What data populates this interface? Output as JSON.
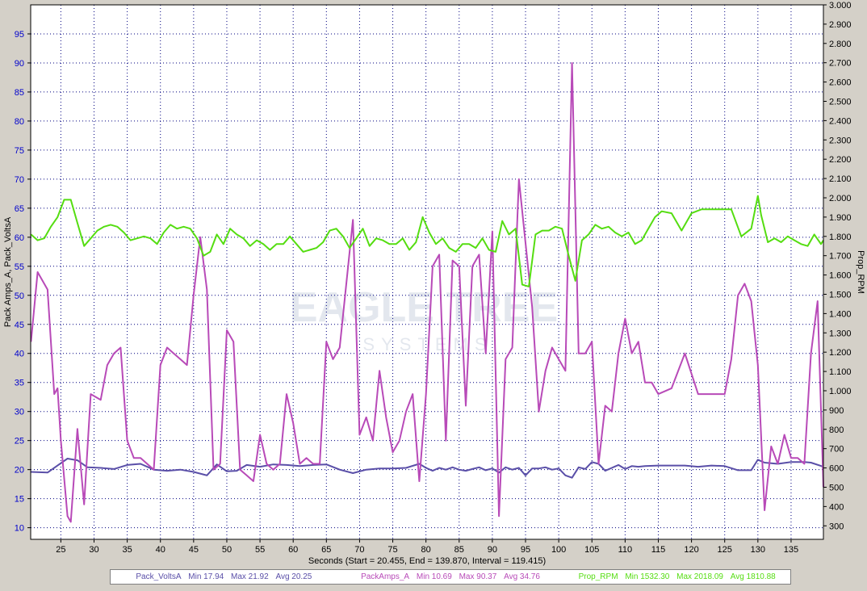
{
  "chart_data": {
    "type": "line",
    "xlabel": "Seconds (Start = 20.455, End = 139.870, Interval = 119.415)",
    "ylabel_left": "Pack Amps_A, Pack_VoltsA",
    "ylabel_right": "Prop_RPM",
    "xlim": [
      20.455,
      139.87
    ],
    "ylim_left": [
      8,
      100
    ],
    "ylim_right": [
      230,
      3000
    ],
    "x_ticks": [
      25,
      30,
      35,
      40,
      45,
      50,
      55,
      60,
      65,
      70,
      75,
      80,
      85,
      90,
      95,
      100,
      105,
      110,
      115,
      120,
      125,
      130,
      135
    ],
    "y_left_ticks": [
      10,
      15,
      20,
      25,
      30,
      35,
      40,
      45,
      50,
      55,
      60,
      65,
      70,
      75,
      80,
      85,
      90,
      95
    ],
    "y_right_ticks": [
      "300",
      "400",
      "500",
      "600",
      "700",
      "800",
      "900",
      "1.000",
      "1.100",
      "1.200",
      "1.300",
      "1.400",
      "1.500",
      "1.600",
      "1.700",
      "1.800",
      "1.900",
      "2.000",
      "2.100",
      "2.200",
      "2.300",
      "2.400",
      "2.500",
      "2.600",
      "2.700",
      "2.800",
      "2.900",
      "3.000"
    ],
    "grid": true,
    "watermark_text": "EAGLE TREE",
    "watermark_sub": "SYSTEMS",
    "series": [
      {
        "name": "Pack_VoltsA",
        "axis": "left",
        "color": "#5a4fa8",
        "legend": {
          "name": "Pack_VoltsA",
          "min": "Min 17.94",
          "max": "Max 21.92",
          "avg": "Avg 20.25"
        },
        "x": [
          20.5,
          23,
          24.5,
          26,
          27.5,
          29,
          31,
          33,
          35,
          37,
          39,
          41,
          43,
          45,
          47,
          48.5,
          50,
          51.5,
          53,
          55,
          57,
          59,
          61,
          63,
          65,
          67,
          69,
          71,
          73,
          75,
          77,
          79,
          80,
          81,
          82,
          83,
          84,
          85,
          86,
          87,
          88,
          89,
          90,
          91,
          92,
          93,
          94,
          95,
          96,
          97,
          98,
          99,
          100,
          101,
          102,
          103,
          104,
          105,
          106,
          107,
          108,
          109,
          110,
          111,
          112,
          113,
          115,
          117,
          119,
          121,
          123,
          125,
          127,
          128,
          129,
          130,
          131,
          133,
          135,
          137,
          138,
          139.87
        ],
        "y": [
          19.6,
          19.5,
          20.7,
          21.9,
          21.6,
          20.4,
          20.3,
          20.1,
          20.8,
          21.0,
          20.0,
          19.8,
          20.0,
          19.6,
          19.0,
          20.9,
          19.7,
          19.8,
          20.8,
          20.5,
          20.9,
          20.8,
          20.6,
          20.8,
          20.9,
          20.0,
          19.4,
          20.0,
          20.2,
          20.2,
          20.3,
          21.0,
          20.3,
          19.8,
          20.3,
          20.0,
          20.4,
          20.0,
          19.8,
          20.1,
          20.4,
          19.9,
          20.2,
          19.5,
          20.4,
          20.0,
          20.3,
          19.0,
          20.2,
          20.2,
          20.4,
          20.0,
          20.2,
          19.0,
          18.6,
          20.4,
          20.1,
          21.3,
          21.0,
          19.8,
          20.3,
          20.8,
          20.1,
          20.6,
          20.5,
          20.6,
          20.7,
          20.7,
          20.7,
          20.5,
          20.7,
          20.6,
          19.9,
          19.9,
          19.9,
          21.7,
          21.2,
          21.0,
          21.3,
          21.3,
          21.2,
          20.5
        ]
      },
      {
        "name": "PackAmps_A",
        "axis": "left",
        "color": "#b84ab8",
        "legend": {
          "name": "PackAmps_A",
          "min": "Min 10.69",
          "max": "Max 90.37",
          "avg": "Avg 34.76"
        },
        "x": [
          20.5,
          21.5,
          23,
          24,
          24.5,
          25,
          26,
          26.5,
          27.5,
          28.5,
          29.5,
          31,
          32,
          33,
          34,
          35,
          36,
          37,
          38,
          39,
          40,
          41,
          42,
          43,
          44,
          45,
          46,
          47,
          48,
          49,
          50,
          51,
          52,
          53,
          54,
          55,
          56,
          57,
          58,
          59,
          60,
          61,
          62,
          63,
          64,
          65,
          66,
          67,
          68,
          69,
          70,
          71,
          72,
          73,
          74,
          75,
          76,
          77,
          78,
          79,
          80,
          81,
          82,
          83,
          84,
          85,
          86,
          87,
          88,
          89,
          90,
          91,
          92,
          93,
          94,
          95,
          96,
          97,
          98,
          99,
          100,
          101,
          102,
          103,
          104,
          105,
          106,
          107,
          108,
          109,
          110,
          111,
          112,
          113,
          114,
          115,
          117,
          119,
          121,
          123,
          125,
          126,
          127,
          128,
          129,
          130,
          131,
          132,
          133,
          134,
          135,
          136,
          137,
          138,
          139,
          139.87
        ],
        "y": [
          42,
          54,
          51,
          33,
          34,
          25,
          12,
          11,
          27,
          14,
          33,
          32,
          38,
          40,
          41,
          25,
          22,
          22,
          21,
          20,
          38,
          41,
          40,
          39,
          38,
          50,
          60,
          51,
          20,
          21,
          44,
          42,
          20,
          19,
          18,
          26,
          21,
          20,
          21,
          33,
          28,
          21,
          22,
          21,
          21,
          42,
          39,
          41,
          52,
          63,
          26,
          29,
          25,
          37,
          29,
          23,
          25,
          30,
          33,
          18,
          33,
          55,
          57,
          25,
          56,
          55,
          31,
          55,
          57,
          40,
          61,
          12,
          39,
          41,
          70,
          59,
          48,
          30,
          37,
          41,
          39,
          37,
          90,
          40,
          40,
          42,
          21,
          31,
          30,
          40,
          46,
          40,
          42,
          35,
          35,
          33,
          34,
          40,
          33,
          33,
          33,
          39,
          50,
          52,
          49,
          38,
          13,
          24,
          21,
          26,
          22,
          22,
          21,
          40,
          49,
          17
        ]
      },
      {
        "name": "Prop_RPM",
        "axis": "right",
        "color": "#55dd11",
        "legend": {
          "name": "Prop_RPM",
          "min": "Min 1532.30",
          "max": "Max 2018.09",
          "avg": "Avg 1810.88"
        },
        "x": [
          20.5,
          21.5,
          22.5,
          23.5,
          24.5,
          25.5,
          26.5,
          27.5,
          28.5,
          29.5,
          30.5,
          31.5,
          32.5,
          33.5,
          34.5,
          35.5,
          36.5,
          37.5,
          38.5,
          39.5,
          40.5,
          41.5,
          42.5,
          43.5,
          44.5,
          45.5,
          46.5,
          47.5,
          48.5,
          49.5,
          50.5,
          51.5,
          52.5,
          53.5,
          54.5,
          55.5,
          56.5,
          57.5,
          58.5,
          59.5,
          60.5,
          61.5,
          62.5,
          63.5,
          64.5,
          65.5,
          66.5,
          67.5,
          68.5,
          69.5,
          70.5,
          71.5,
          72.5,
          73.5,
          74.5,
          75.5,
          76.5,
          77.5,
          78.5,
          79.5,
          80.5,
          81.5,
          82.5,
          83.5,
          84.5,
          85.5,
          86.5,
          87.5,
          88.5,
          89.5,
          90.5,
          91.5,
          92.5,
          93.5,
          94.5,
          95.5,
          96.5,
          97.5,
          98.5,
          99.5,
          100.5,
          101.5,
          102.5,
          103.5,
          104.5,
          105.5,
          106.5,
          107.5,
          108.5,
          109.5,
          110.5,
          111.5,
          112.5,
          113.5,
          114.5,
          115.5,
          117,
          118.5,
          120,
          121.5,
          123,
          124.5,
          126,
          127.5,
          129,
          130,
          130.5,
          131.5,
          132.5,
          133.5,
          134.5,
          135.5,
          136.5,
          137.5,
          138.5,
          139.5,
          139.87
        ],
        "y": [
          1810,
          1780,
          1790,
          1850,
          1900,
          1990,
          1990,
          1870,
          1750,
          1790,
          1830,
          1850,
          1860,
          1850,
          1820,
          1780,
          1790,
          1800,
          1790,
          1760,
          1820,
          1860,
          1840,
          1850,
          1840,
          1790,
          1700,
          1720,
          1810,
          1760,
          1840,
          1810,
          1790,
          1750,
          1780,
          1760,
          1730,
          1760,
          1760,
          1800,
          1760,
          1720,
          1730,
          1740,
          1770,
          1830,
          1840,
          1800,
          1740,
          1790,
          1840,
          1750,
          1790,
          1780,
          1760,
          1760,
          1790,
          1730,
          1770,
          1900,
          1820,
          1760,
          1790,
          1740,
          1720,
          1760,
          1760,
          1740,
          1790,
          1730,
          1720,
          1880,
          1810,
          1840,
          1550,
          1540,
          1810,
          1830,
          1830,
          1850,
          1840,
          1700,
          1570,
          1780,
          1810,
          1860,
          1840,
          1850,
          1820,
          1800,
          1820,
          1760,
          1780,
          1840,
          1900,
          1930,
          1920,
          1830,
          1920,
          1940,
          1940,
          1940,
          1940,
          1800,
          1840,
          2010,
          1910,
          1770,
          1790,
          1770,
          1800,
          1780,
          1760,
          1750,
          1810,
          1760,
          1780
        ]
      }
    ]
  }
}
